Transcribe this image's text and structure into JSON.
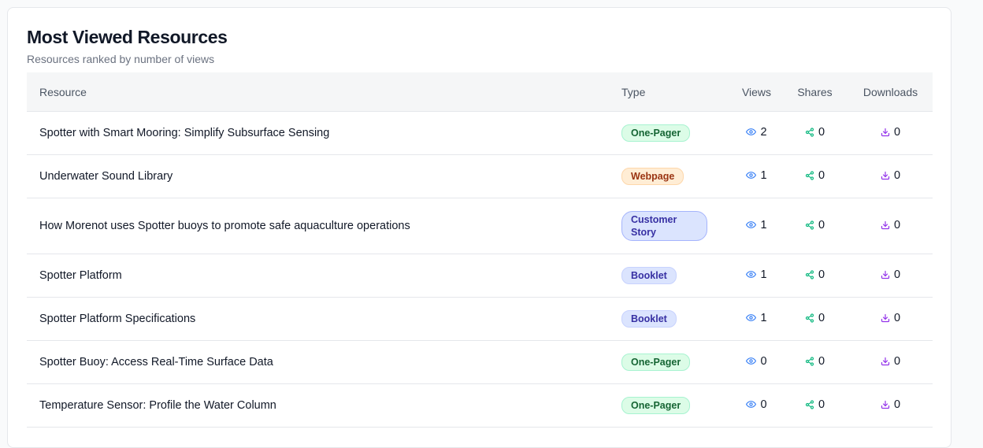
{
  "header": {
    "title": "Most Viewed Resources",
    "subtitle": "Resources ranked by number of views"
  },
  "table": {
    "columns": {
      "resource": "Resource",
      "type": "Type",
      "views": "Views",
      "shares": "Shares",
      "downloads": "Downloads"
    },
    "rows": [
      {
        "resource": "Spotter with Smart Mooring: Simplify Subsurface Sensing",
        "type": "One-Pager",
        "views": "2",
        "shares": "0",
        "downloads": "0"
      },
      {
        "resource": "Underwater Sound Library",
        "type": "Webpage",
        "views": "1",
        "shares": "0",
        "downloads": "0"
      },
      {
        "resource": "How Morenot uses Spotter buoys to promote safe aquaculture operations",
        "type": "Customer Story",
        "views": "1",
        "shares": "0",
        "downloads": "0"
      },
      {
        "resource": "Spotter Platform",
        "type": "Booklet",
        "views": "1",
        "shares": "0",
        "downloads": "0"
      },
      {
        "resource": "Spotter Platform Specifications",
        "type": "Booklet",
        "views": "1",
        "shares": "0",
        "downloads": "0"
      },
      {
        "resource": "Spotter Buoy: Access Real-Time Surface Data",
        "type": "One-Pager",
        "views": "0",
        "shares": "0",
        "downloads": "0"
      },
      {
        "resource": "Temperature Sensor: Profile the Water Column",
        "type": "One-Pager",
        "views": "0",
        "shares": "0",
        "downloads": "0"
      }
    ]
  },
  "icons": {
    "views": "eye-icon",
    "shares": "share-icon",
    "downloads": "download-icon"
  },
  "colors": {
    "views_icon": "#3b82f6",
    "shares_icon": "#10b981",
    "downloads_icon": "#9333ea",
    "badge_one_pager": {
      "bg": "#dcfce7",
      "border": "#a7f3d0",
      "text": "#166534"
    },
    "badge_webpage": {
      "bg": "#ffedd5",
      "border": "#fed7aa",
      "text": "#9a3412"
    },
    "badge_customer_story": {
      "bg": "#dbe4fe",
      "border": "#a5b4fc",
      "text": "#3730a3"
    },
    "badge_booklet": {
      "bg": "#dbe4fe",
      "border": "#c7d2fe",
      "text": "#3730a3"
    }
  }
}
